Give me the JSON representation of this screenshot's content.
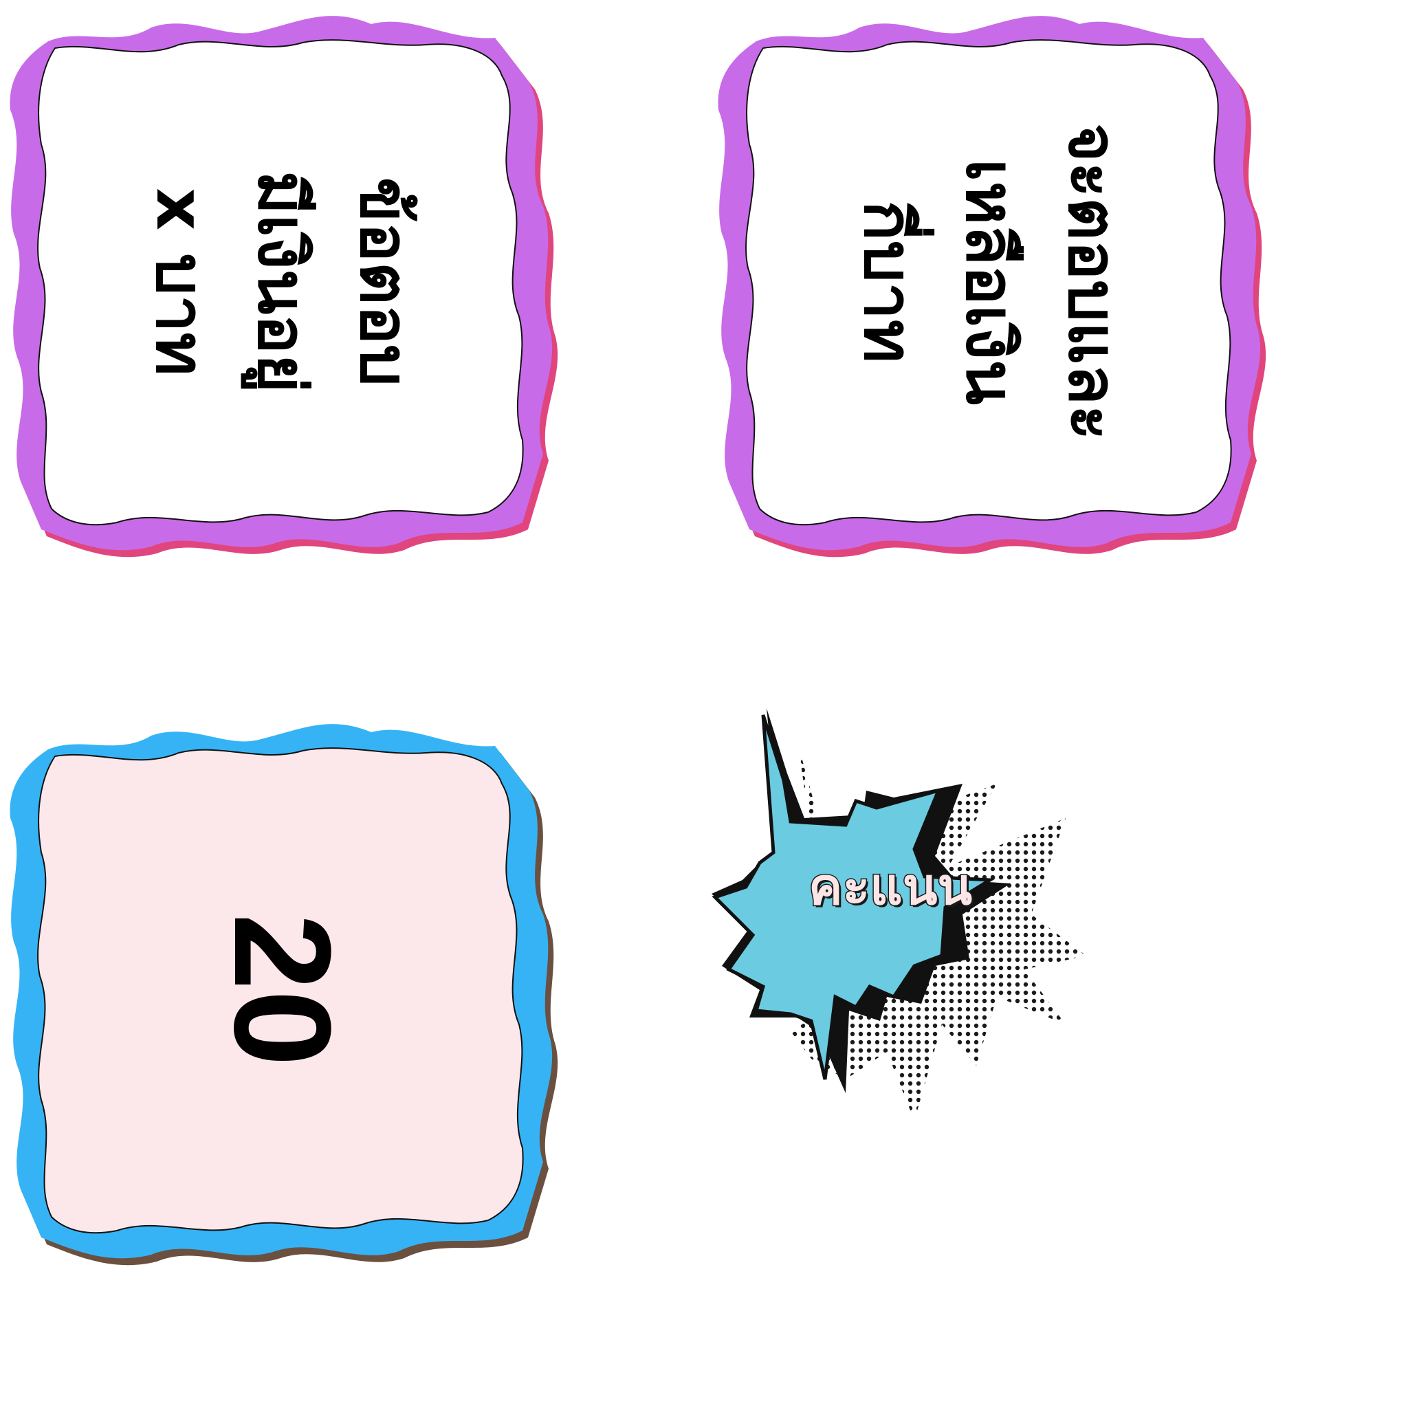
{
  "cards": [
    {
      "lines": [
        "ข้อตอบ",
        "มีเงินอยู่",
        "x บาท"
      ],
      "frame_color": "#c86be8",
      "shadow_color": "#e0457e",
      "fill_color": "#ffffff"
    },
    {
      "lines": [
        "จะตอบและ",
        "เหลือเงิน",
        "กี่บาท"
      ],
      "frame_color": "#c86be8",
      "shadow_color": "#e0457e",
      "fill_color": "#ffffff"
    },
    {
      "lines": [
        "20"
      ],
      "frame_color": "#36b3f5",
      "shadow_color": "#6b5040",
      "fill_color": "#fce8ea"
    }
  ],
  "score": {
    "label": "คะแนน",
    "burst_color": "#6bcbe0",
    "label_color": "#fbe5e6"
  }
}
